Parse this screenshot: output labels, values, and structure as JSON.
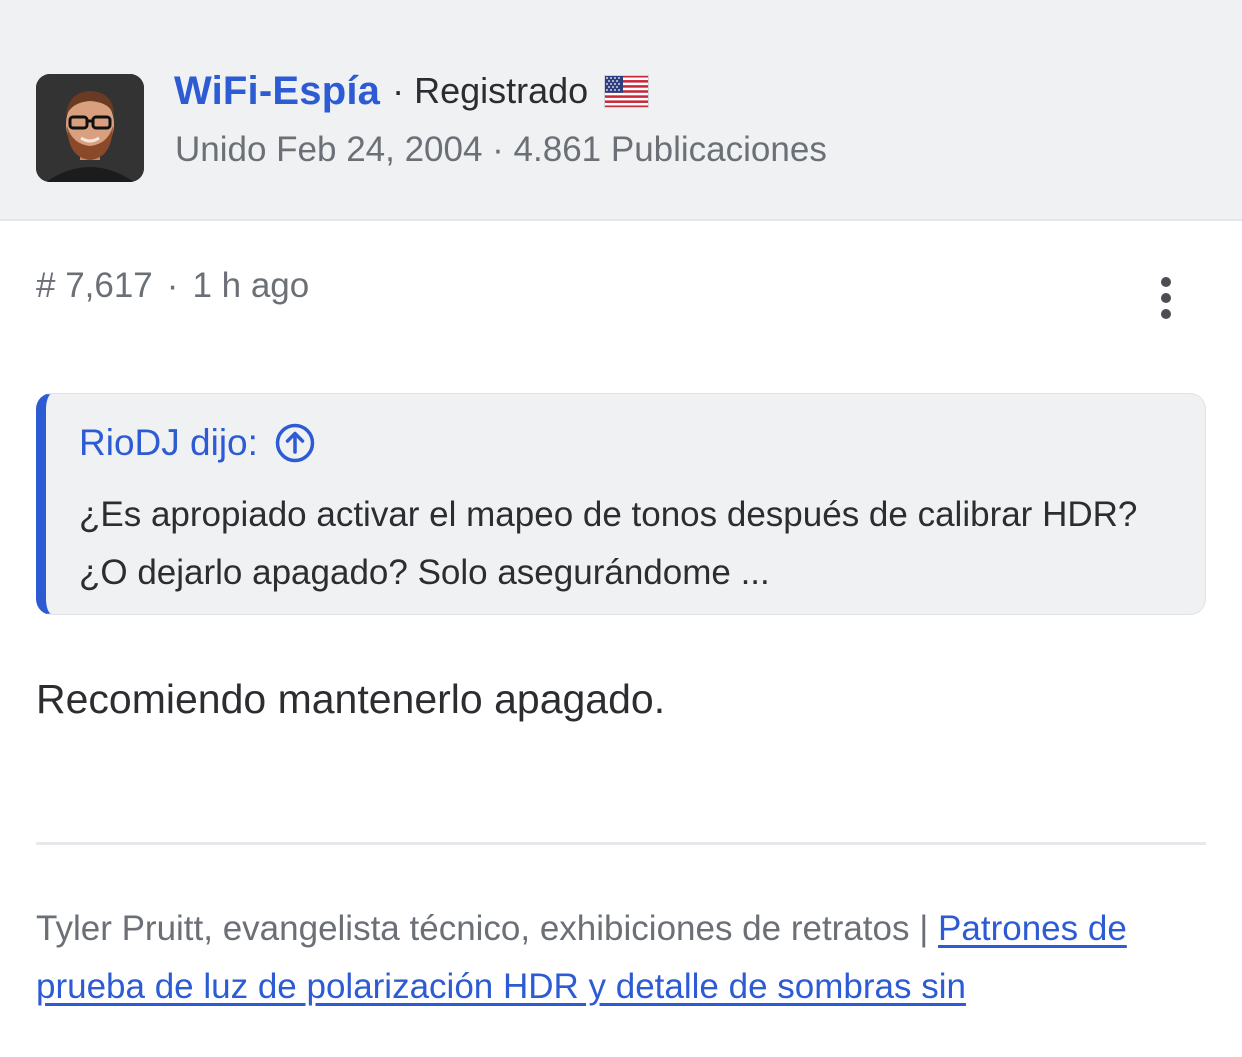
{
  "user": {
    "username": "WiFi-Espía",
    "separator": "·",
    "role": "Registrado",
    "country_flag_icon": "us-flag-icon",
    "meta": "Unido Feb 24, 2004 · 4.861 Publicaciones",
    "avatar_icon": "user-avatar"
  },
  "post": {
    "number": "# 7,617",
    "dot": "·",
    "time": "1 h ago",
    "more_icon": "vertical-ellipsis-icon",
    "body": "Recomiendo mantenerlo apagado."
  },
  "quote": {
    "author_label": "RioDJ dijo:",
    "jump_icon": "arrow-up-circle-icon",
    "text": "¿Es apropiado activar el mapeo de tonos después de calibrar HDR? ¿O dejarlo apagado? Solo asegurándome ..."
  },
  "signature": {
    "text": "Tyler Pruitt, evangelista técnico, exhibiciones de retratos | ",
    "link_text": "Patrones de prueba de luz de polarización HDR y detalle de sombras sin"
  },
  "colors": {
    "accent": "#2c5bd3",
    "muted_text": "#6b6f76",
    "header_bg": "#f0f1f3"
  }
}
